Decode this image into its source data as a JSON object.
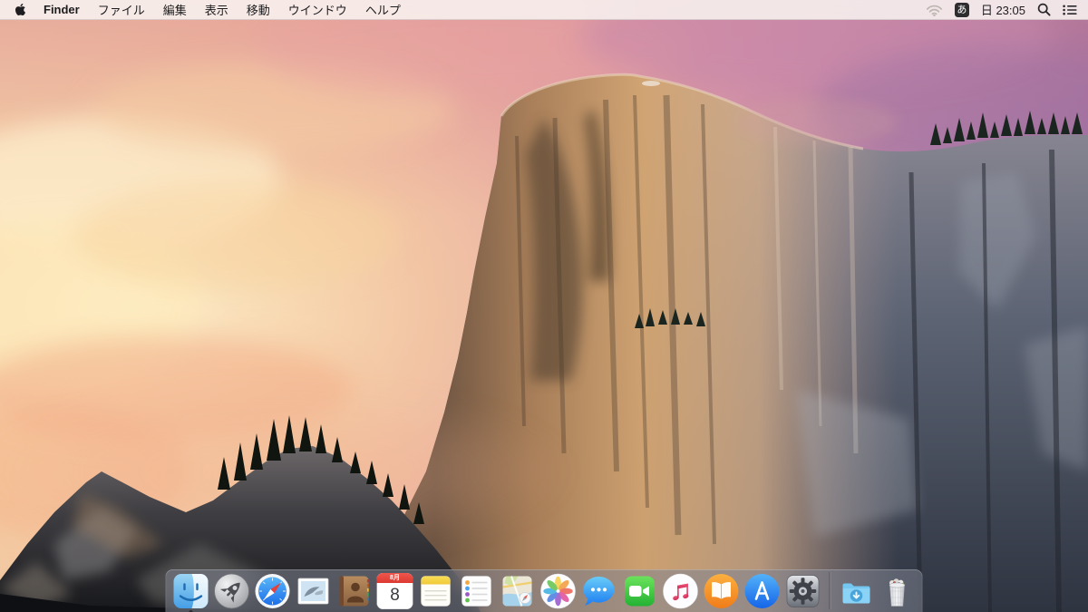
{
  "menubar": {
    "app_name": "Finder",
    "menus": [
      {
        "label": "ファイル"
      },
      {
        "label": "編集"
      },
      {
        "label": "表示"
      },
      {
        "label": "移動"
      },
      {
        "label": "ウインドウ"
      },
      {
        "label": "ヘルプ"
      }
    ],
    "status": {
      "wifi_icon": "wifi-icon-dimmed",
      "input_badge": "あ",
      "clock": "日 23:05",
      "spotlight_icon": "magnifier-icon",
      "notification_icon": "notification-list-icon"
    }
  },
  "dock": {
    "items": [
      {
        "name": "Finder",
        "icon": "finder-icon",
        "running": true
      },
      {
        "name": "Launchpad",
        "icon": "launchpad-rocket-icon"
      },
      {
        "name": "Safari",
        "icon": "safari-compass-icon"
      },
      {
        "name": "Mail",
        "icon": "mail-stamp-icon"
      },
      {
        "name": "Contacts",
        "icon": "contacts-book-icon"
      },
      {
        "name": "Calendar",
        "icon": "calendar-icon",
        "badge_month": "8月",
        "badge_day": "8"
      },
      {
        "name": "Notes",
        "icon": "notes-icon"
      },
      {
        "name": "Reminders",
        "icon": "reminders-icon"
      },
      {
        "name": "Maps",
        "icon": "maps-icon"
      },
      {
        "name": "Photos",
        "icon": "photos-flower-icon"
      },
      {
        "name": "Messages",
        "icon": "messages-bubble-icon"
      },
      {
        "name": "FaceTime",
        "icon": "facetime-camera-icon"
      },
      {
        "name": "iTunes",
        "icon": "itunes-note-icon"
      },
      {
        "name": "iBooks",
        "icon": "ibooks-icon"
      },
      {
        "name": "App Store",
        "icon": "app-store-icon"
      },
      {
        "name": "System Preferences",
        "icon": "system-preferences-gear-icon"
      },
      {
        "name": "Downloads",
        "icon": "downloads-folder-icon"
      },
      {
        "name": "Trash",
        "icon": "trash-full-icon",
        "state": "full"
      }
    ]
  },
  "colors": {
    "menubar_bg": "#f6f0ed",
    "dock_bg": "rgba(127,131,145,0.55)",
    "sky_left": "#f1c4a0",
    "sky_right": "#9a6b9e",
    "calendar_red": "#e8473f"
  }
}
